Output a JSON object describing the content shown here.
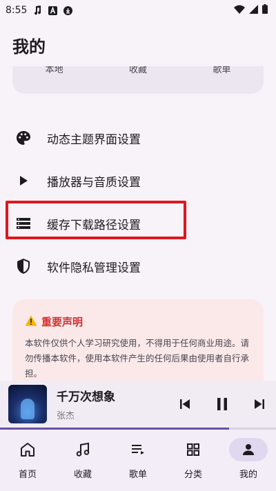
{
  "status_bar": {
    "time": "8:55",
    "left_icons": [
      "music-note-icon",
      "font-a-icon",
      "download-circle-icon"
    ],
    "right_icons": [
      "wifi-icon",
      "signal-icon",
      "battery-icon"
    ]
  },
  "page": {
    "title": "我的"
  },
  "quick_card": {
    "items": [
      "本地",
      "收藏",
      "歌单"
    ]
  },
  "settings": [
    {
      "label": "动态主题界面设置",
      "icon": "palette-icon"
    },
    {
      "label": "播放器与音质设置",
      "icon": "play-icon"
    },
    {
      "label": "缓存下载路径设置",
      "icon": "storage-list-icon",
      "highlighted": true
    },
    {
      "label": "软件隐私管理设置",
      "icon": "shield-icon"
    }
  ],
  "notice": {
    "icon": "warning-icon",
    "title": "重要声明",
    "body": "本软件仅供个人学习研究使用，不得用于任何商业用途。请勿传播本软件，使用本软件产生的任何后果由使用者自行承担。"
  },
  "player": {
    "track_title": "千万次想象",
    "artist": "张杰",
    "progress": 0.83,
    "controls": [
      "skip-previous-icon",
      "pause-icon",
      "skip-next-icon"
    ]
  },
  "nav": {
    "items": [
      {
        "label": "首页",
        "icon": "home-icon"
      },
      {
        "label": "收藏",
        "icon": "music-note-icon"
      },
      {
        "label": "歌单",
        "icon": "playlist-icon"
      },
      {
        "label": "分类",
        "icon": "grid-icon"
      },
      {
        "label": "我的",
        "icon": "person-icon",
        "active": true
      }
    ]
  },
  "colors": {
    "background": "#f7f3f8",
    "highlight_border": "#e0161e",
    "notice_bg": "#fbe9ea",
    "notice_title": "#d32f2f",
    "accent": "#6750a4"
  }
}
